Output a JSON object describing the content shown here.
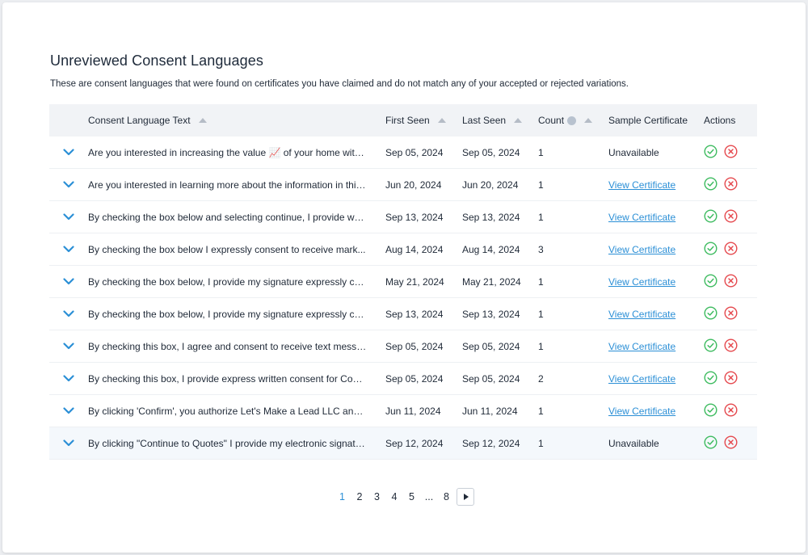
{
  "page": {
    "title": "Unreviewed Consent Languages",
    "subtitle": "These are consent languages that were found on certificates you have claimed and do not match any of your accepted or rejected variations."
  },
  "table": {
    "headers": {
      "text": "Consent Language Text",
      "first_seen": "First Seen",
      "last_seen": "Last Seen",
      "count": "Count",
      "sample": "Sample Certificate",
      "actions": "Actions"
    },
    "rows": [
      {
        "text": "Are you interested in increasing the value 📈 of your home with...",
        "first_seen": "Sep 05, 2024",
        "last_seen": "Sep 05, 2024",
        "count": "1",
        "sample": "Unavailable",
        "sample_is_link": false
      },
      {
        "text": "Are you interested in learning more about the information in this...",
        "first_seen": "Jun 20, 2024",
        "last_seen": "Jun 20, 2024",
        "count": "1",
        "sample": "View Certificate",
        "sample_is_link": true
      },
      {
        "text": "By checking the box below and selecting continue, I provide wri...",
        "first_seen": "Sep 13, 2024",
        "last_seen": "Sep 13, 2024",
        "count": "1",
        "sample": "View Certificate",
        "sample_is_link": true
      },
      {
        "text": "By checking the box below I expressly consent to receive mark...",
        "first_seen": "Aug 14, 2024",
        "last_seen": "Aug 14, 2024",
        "count": "3",
        "sample": "View Certificate",
        "sample_is_link": true
      },
      {
        "text": "By checking the box below, I provide my signature expressly co...",
        "first_seen": "May 21, 2024",
        "last_seen": "May 21, 2024",
        "count": "1",
        "sample": "View Certificate",
        "sample_is_link": true
      },
      {
        "text": "By checking the box below, I provide my signature expressly co...",
        "first_seen": "Sep 13, 2024",
        "last_seen": "Sep 13, 2024",
        "count": "1",
        "sample": "View Certificate",
        "sample_is_link": true
      },
      {
        "text": "By checking this box, I agree and consent to receive text messa...",
        "first_seen": "Sep 05, 2024",
        "last_seen": "Sep 05, 2024",
        "count": "1",
        "sample": "View Certificate",
        "sample_is_link": true
      },
      {
        "text": "By checking this box, I provide express written consent for Cons...",
        "first_seen": "Sep 05, 2024",
        "last_seen": "Sep 05, 2024",
        "count": "2",
        "sample": "View Certificate",
        "sample_is_link": true
      },
      {
        "text": "By clicking 'Confirm', you authorize Let's Make a Lead LLC and u...",
        "first_seen": "Jun 11, 2024",
        "last_seen": "Jun 11, 2024",
        "count": "1",
        "sample": "View Certificate",
        "sample_is_link": true
      },
      {
        "text": "By clicking \"Continue to Quotes\" I provide my electronic signatu...",
        "first_seen": "Sep 12, 2024",
        "last_seen": "Sep 12, 2024",
        "count": "1",
        "sample": "Unavailable",
        "sample_is_link": false
      }
    ]
  },
  "pagination": {
    "pages": [
      "1",
      "2",
      "3",
      "4",
      "5",
      "...",
      "8"
    ],
    "current": "1"
  },
  "colors": {
    "accent": "#2b8fd6",
    "accept": "#3dbb5f",
    "reject": "#e5484d",
    "header_bg": "#f1f3f6"
  },
  "icons": {
    "expand": "chevron-down-icon",
    "accept": "check-circle-icon",
    "reject": "x-circle-icon",
    "info": "info-icon",
    "next": "caret-right-icon"
  }
}
